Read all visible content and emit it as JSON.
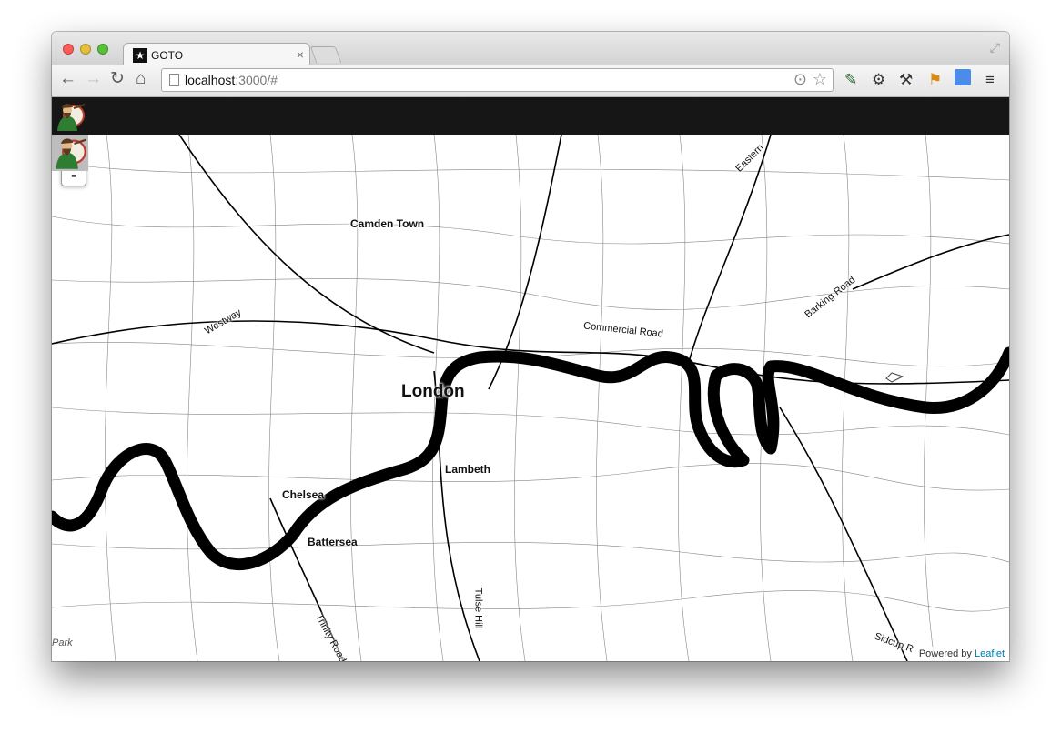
{
  "browser": {
    "tab_title": "GOTO",
    "tab_close": "×",
    "fullscreen_icon": "⤢",
    "url_host": "localhost",
    "url_rest": ":3000/#",
    "nav": {
      "back": "←",
      "forward": "→",
      "reload": "↻",
      "home": "⌂"
    },
    "extensions": [
      "pen-icon",
      "gear-icon",
      "wrench-icon",
      "flag-icon",
      "google-icon",
      "menu-icon"
    ]
  },
  "map": {
    "zoom_in": "+",
    "zoom_out": "-",
    "labels": {
      "camden_town": "Camden Town",
      "london": "London",
      "westway": "Westway",
      "commercial_road": "Commercial Road",
      "barking_road": "Barking Road",
      "eastern": "Eastern",
      "lambeth": "Lambeth",
      "chelsea": "Chelsea",
      "battersea": "Battersea",
      "tulse_hill": "Tulse Hill",
      "trinity_road": "Trinity Road",
      "sidcup": "Sidcup R",
      "park": "Park"
    },
    "attribution_prefix": "Powered by ",
    "attribution_link": "Leaflet"
  },
  "colors": {
    "appbar": "#161616",
    "river": "#000000",
    "link": "#0078a8"
  }
}
